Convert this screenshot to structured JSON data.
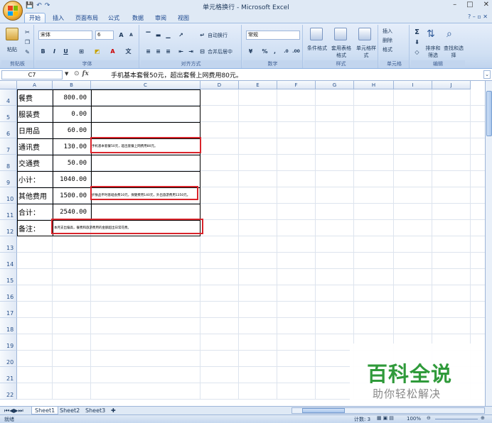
{
  "window": {
    "title": "单元格换行 - Microsoft Excel",
    "controls": [
      "–",
      "□",
      "✕"
    ]
  },
  "qat": {
    "save": "💾",
    "undo": "↶",
    "redo": "↷"
  },
  "ribbon_tabs": [
    "开始",
    "插入",
    "页面布局",
    "公式",
    "数据",
    "审阅",
    "视图"
  ],
  "active_tab": "开始",
  "ribbon": {
    "clipboard": {
      "paste": "粘贴",
      "label": "剪贴板"
    },
    "font": {
      "name": "宋体",
      "size": "6",
      "bold": "B",
      "italic": "I",
      "underline": "U",
      "label": "字体",
      "grow": "A",
      "shrink": "A"
    },
    "alignment": {
      "wrap": "自动换行",
      "merge": "合并后居中",
      "label": "对齐方式"
    },
    "number": {
      "format": "常规",
      "percent": "%",
      "comma": ",",
      "label": "数字"
    },
    "styles": {
      "conditional": "条件格式",
      "table": "套用表格格式",
      "cell": "单元格样式",
      "label": "样式"
    },
    "cells": {
      "insert": "插入",
      "delete": "删除",
      "format": "格式",
      "label": "单元格"
    },
    "editing": {
      "sort": "排序和筛选",
      "find": "查找和选择",
      "sigma": "Σ",
      "label": "编辑"
    }
  },
  "formula_bar": {
    "name_box": "C7",
    "fx": "fx",
    "content": "手机基本套餐50元，超出套餐上网费用80元。"
  },
  "columns": [
    "A",
    "B",
    "C",
    "D",
    "E",
    "F",
    "G",
    "H",
    "I",
    "J"
  ],
  "rows": [
    {
      "num": "4",
      "label": "餐费",
      "value": "800.00",
      "note": ""
    },
    {
      "num": "5",
      "label": "服装费",
      "value": "0.00",
      "note": ""
    },
    {
      "num": "6",
      "label": "日用品",
      "value": "60.00",
      "note": ""
    },
    {
      "num": "7",
      "label": "通讯费",
      "value": "130.00",
      "note": "手机基本套餐50元，超出套餐上网费用80元。"
    },
    {
      "num": "8",
      "label": "交通费",
      "value": "50.00",
      "note": ""
    },
    {
      "num": "9",
      "label": "小计：",
      "value": "1040.00",
      "note": ""
    },
    {
      "num": "10",
      "label": "其他费用",
      "value": "1500.00",
      "note": "护肤品平时基础会费10元，保健费用140元，外出旅游费用1350元。"
    },
    {
      "num": "11",
      "label": "合计：",
      "value": "2540.00",
      "note": ""
    },
    {
      "num": "12",
      "label": "备注：",
      "value": "",
      "note": "本月支出偏高，餐费和旅游费用的金额超出日常花费。"
    }
  ],
  "empty_rows": [
    "13",
    "14",
    "15",
    "16",
    "17",
    "18",
    "19",
    "20",
    "21",
    "22"
  ],
  "sheets": [
    "Sheet1",
    "Sheet2",
    "Sheet3"
  ],
  "status": {
    "ready": "就绪",
    "count": "计数: 3",
    "zoom": "100%"
  },
  "watermark": {
    "main": "百科全说",
    "sub": "助你轻松解决"
  }
}
